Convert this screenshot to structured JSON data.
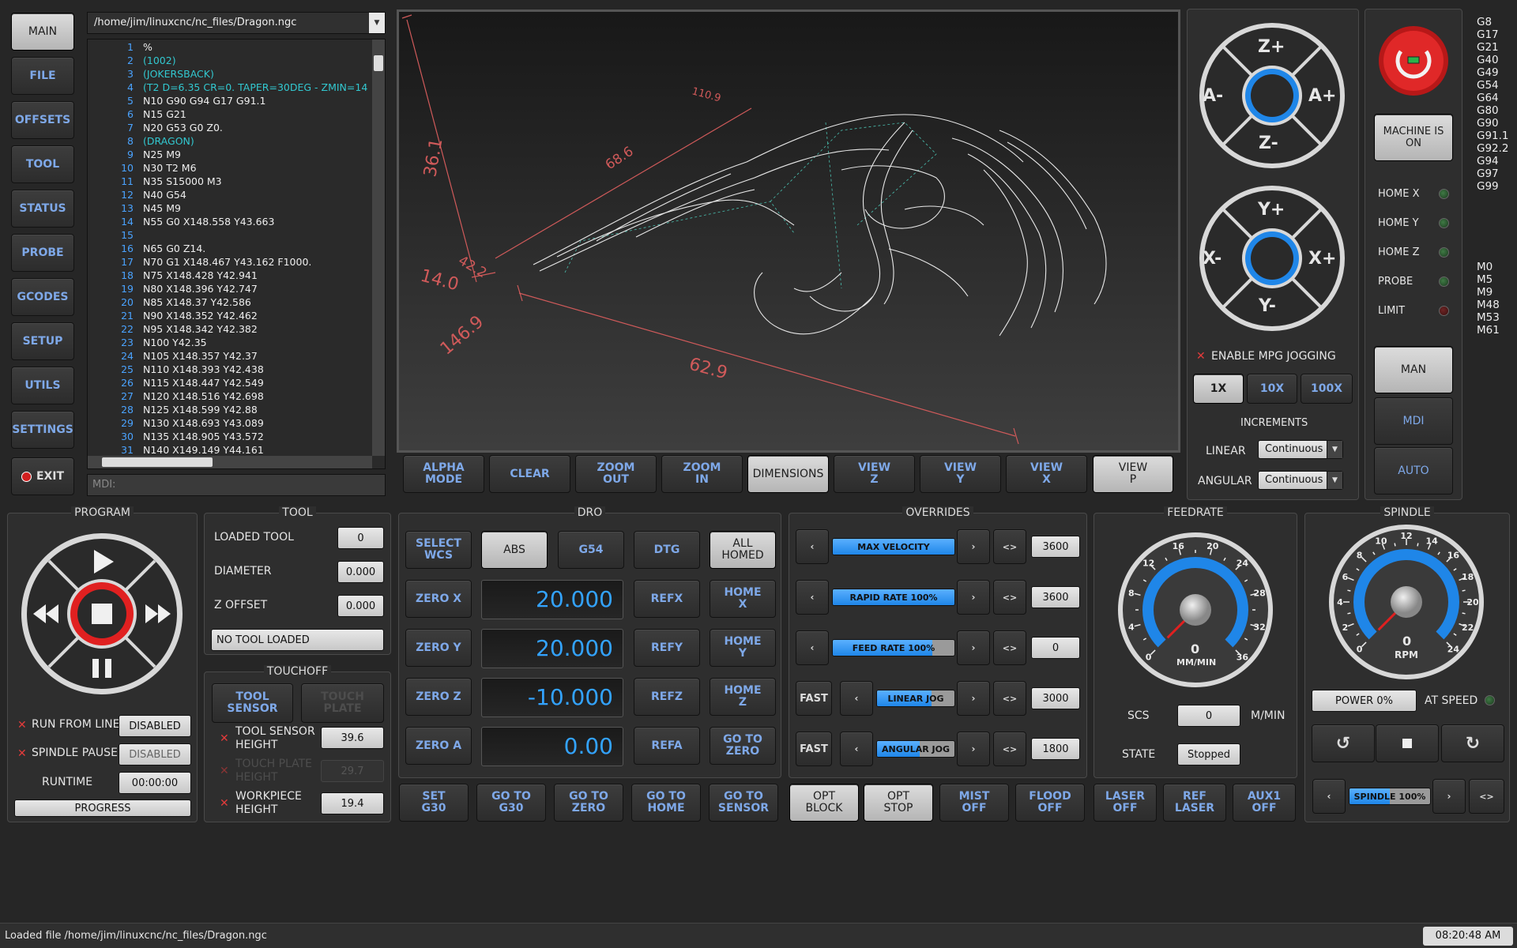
{
  "nav": [
    {
      "label": "MAIN",
      "active": true
    },
    {
      "label": "FILE"
    },
    {
      "label": "OFFSETS"
    },
    {
      "label": "TOOL"
    },
    {
      "label": "STATUS"
    },
    {
      "label": "PROBE"
    },
    {
      "label": "GCODES"
    },
    {
      "label": "SETUP"
    },
    {
      "label": "UTILS"
    },
    {
      "label": "SETTINGS"
    }
  ],
  "exit_label": "EXIT",
  "file_path": "/home/jim/linuxcnc/nc_files/Dragon.ngc",
  "mdi_placeholder": "MDI:",
  "gcode": [
    {
      "n": "1",
      "t": "%"
    },
    {
      "n": "2",
      "t": "(1002)",
      "c": true
    },
    {
      "n": "3",
      "t": "(JOKERSBACK)",
      "c": true
    },
    {
      "n": "4",
      "t": "(T2  D=6.35 CR=0. TAPER=30DEG - ZMIN=14",
      "c": true
    },
    {
      "n": "5",
      "t": "N10 G90 G94 G17 G91.1"
    },
    {
      "n": "6",
      "t": "N15 G21"
    },
    {
      "n": "7",
      "t": "N20 G53 G0 Z0."
    },
    {
      "n": "8",
      "t": "(DRAGON)",
      "c": true
    },
    {
      "n": "9",
      "t": "N25 M9"
    },
    {
      "n": "10",
      "t": "N30 T2 M6"
    },
    {
      "n": "11",
      "t": "N35 S15000 M3"
    },
    {
      "n": "12",
      "t": "N40 G54"
    },
    {
      "n": "13",
      "t": "N45 M9"
    },
    {
      "n": "14",
      "t": "N55 G0 X148.558 Y43.663"
    },
    {
      "n": "15",
      "t": ""
    },
    {
      "n": "16",
      "t": "N65 G0 Z14."
    },
    {
      "n": "17",
      "t": "N70 G1 X148.467 Y43.162 F1000."
    },
    {
      "n": "18",
      "t": "N75 X148.428 Y42.941"
    },
    {
      "n": "19",
      "t": "N80 X148.396 Y42.747"
    },
    {
      "n": "20",
      "t": "N85 X148.37 Y42.586"
    },
    {
      "n": "21",
      "t": "N90 X148.352 Y42.462"
    },
    {
      "n": "22",
      "t": "N95 X148.342 Y42.382"
    },
    {
      "n": "23",
      "t": "N100 Y42.35"
    },
    {
      "n": "24",
      "t": "N105 X148.357 Y42.37"
    },
    {
      "n": "25",
      "t": "N110 X148.393 Y42.438"
    },
    {
      "n": "26",
      "t": "N115 X148.447 Y42.549"
    },
    {
      "n": "27",
      "t": "N120 X148.516 Y42.698"
    },
    {
      "n": "28",
      "t": "N125 X148.599 Y42.88"
    },
    {
      "n": "29",
      "t": "N130 X148.693 Y43.089"
    },
    {
      "n": "30",
      "t": "N135 X148.905 Y43.572"
    },
    {
      "n": "31",
      "t": "N140 X149.149 Y44.161"
    }
  ],
  "preview": {
    "dims": [
      "110.9",
      "36.1",
      "68.6",
      "42.2",
      "14.0",
      "146.9",
      "62.9"
    ]
  },
  "view_buttons": [
    {
      "l1": "ALPHA",
      "l2": "MODE"
    },
    {
      "l1": "CLEAR",
      "l2": ""
    },
    {
      "l1": "ZOOM",
      "l2": "OUT"
    },
    {
      "l1": "ZOOM",
      "l2": "IN"
    },
    {
      "l1": "DIMENSIONS",
      "l2": "",
      "on": true
    },
    {
      "l1": "VIEW",
      "l2": "Z"
    },
    {
      "l1": "VIEW",
      "l2": "Y"
    },
    {
      "l1": "VIEW",
      "l2": "X"
    },
    {
      "l1": "VIEW",
      "l2": "P",
      "on": true
    }
  ],
  "jog": {
    "zp": "Z+",
    "zm": "Z-",
    "am": "A-",
    "ap": "A+",
    "yp": "Y+",
    "ym": "Y-",
    "xm": "X-",
    "xp": "X+",
    "mpg": "ENABLE MPG JOGGING",
    "inc": [
      "1X",
      "10X",
      "100X"
    ],
    "increments": "INCREMENTS",
    "linear": "LINEAR",
    "angular": "ANGULAR",
    "linear_val": "Continuous",
    "angular_val": "Continuous"
  },
  "machine": {
    "on_label": "MACHINE IS ON",
    "leds": [
      "HOME X",
      "HOME Y",
      "HOME Z",
      "PROBE",
      "LIMIT"
    ],
    "modes": [
      "MAN",
      "MDI",
      "AUTO"
    ]
  },
  "gcodes_active": [
    "G8",
    "G17",
    "G21",
    "G40",
    "G49",
    "G54",
    "G64",
    "G80",
    "G90",
    "G91.1",
    "G92.2",
    "G94",
    "G97",
    "G99"
  ],
  "mcodes_active": [
    "M0",
    "M5",
    "M9",
    "M48",
    "M53",
    "M61"
  ],
  "program": {
    "title": "PROGRAM",
    "run_from_line": "RUN FROM LINE",
    "rfl_val": "DISABLED",
    "spindle_pause": "SPINDLE PAUSE",
    "sp_val": "DISABLED",
    "runtime": "RUNTIME",
    "runtime_val": "00:00:00",
    "progress": "PROGRESS"
  },
  "tool": {
    "title": "TOOL",
    "loaded": "LOADED TOOL",
    "loaded_val": "0",
    "diameter": "DIAMETER",
    "diameter_val": "0.000",
    "zoffset": "Z OFFSET",
    "zoffset_val": "0.000",
    "status": "NO TOOL LOADED"
  },
  "touchoff": {
    "title": "TOUCHOFF",
    "tool_sensor": "TOOL SENSOR",
    "touch_plate": "TOUCH PLATE",
    "ts_height": "TOOL SENSOR HEIGHT",
    "ts_val": "39.6",
    "tp_height": "TOUCH PLATE HEIGHT",
    "tp_val": "29.7",
    "wp_height": "WORKPIECE HEIGHT",
    "wp_val": "19.4"
  },
  "dro": {
    "title": "DRO",
    "select_wcs": "SELECT WCS",
    "abs": "ABS",
    "wcs": "G54",
    "dtg": "DTG",
    "all_homed": "ALL HOMED",
    "axes": [
      {
        "zero": "ZERO X",
        "val": "20.000",
        "ref": "REFX",
        "home": "HOME X"
      },
      {
        "zero": "ZERO Y",
        "val": "20.000",
        "ref": "REFY",
        "home": "HOME Y"
      },
      {
        "zero": "ZERO Z",
        "val": "-10.000",
        "ref": "REFZ",
        "home": "HOME Z"
      },
      {
        "zero": "ZERO A",
        "val": "0.00",
        "ref": "REFA",
        "home": "GO TO ZERO"
      }
    ]
  },
  "bottom_buttons": [
    {
      "l1": "SET",
      "l2": "G30"
    },
    {
      "l1": "GO TO",
      "l2": "G30"
    },
    {
      "l1": "GO TO",
      "l2": "ZERO"
    },
    {
      "l1": "GO TO",
      "l2": "HOME"
    },
    {
      "l1": "GO TO",
      "l2": "SENSOR"
    },
    {
      "l1": "OPT",
      "l2": "BLOCK",
      "on": true
    },
    {
      "l1": "OPT",
      "l2": "STOP",
      "on": true
    },
    {
      "l1": "MIST",
      "l2": "OFF"
    },
    {
      "l1": "FLOOD",
      "l2": "OFF"
    },
    {
      "l1": "LASER",
      "l2": "OFF"
    },
    {
      "l1": "REF",
      "l2": "LASER"
    },
    {
      "l1": "AUX1",
      "l2": "OFF"
    }
  ],
  "overrides": {
    "title": "OVERRIDES",
    "rows": [
      {
        "label": "MAX VELOCITY",
        "fill": 1.0,
        "val": "3600"
      },
      {
        "label": "RAPID RATE 100%",
        "fill": 1.0,
        "val": "3600"
      },
      {
        "label": "FEED RATE 100%",
        "fill": 0.82,
        "val": "0"
      },
      {
        "label": "LINEAR JOG",
        "fill": 0.7,
        "val": "3000",
        "fast": "FAST"
      },
      {
        "label": "ANGULAR JOG",
        "fill": 0.55,
        "val": "1800",
        "fast": "FAST"
      }
    ]
  },
  "feedrate": {
    "title": "FEEDRATE",
    "ticks": [
      "0",
      "4",
      "8",
      "12",
      "16",
      "20",
      "24",
      "28",
      "32",
      "36"
    ],
    "value": "0",
    "unit": "MM/MIN",
    "scs": "SCS",
    "scs_val": "0",
    "scs_unit": "M/MIN",
    "state": "STATE",
    "state_val": "Stopped"
  },
  "spindle": {
    "title": "SPINDLE",
    "ticks": [
      "0",
      "2",
      "4",
      "6",
      "8",
      "10",
      "12",
      "14",
      "16",
      "18",
      "20",
      "22",
      "24"
    ],
    "value": "0",
    "unit": "RPM",
    "power": "POWER 0%",
    "at_speed": "AT SPEED",
    "slider": "SPINDLE 100%",
    "slider_fill": 0.5
  },
  "status_msg": "Loaded file /home/jim/linuxcnc/nc_files/Dragon.ngc",
  "clock": "08:20:48 AM",
  "colors": {
    "accent": "#1f86e8",
    "text_blue": "#7ea8e8",
    "estop": "#d21f1f"
  }
}
